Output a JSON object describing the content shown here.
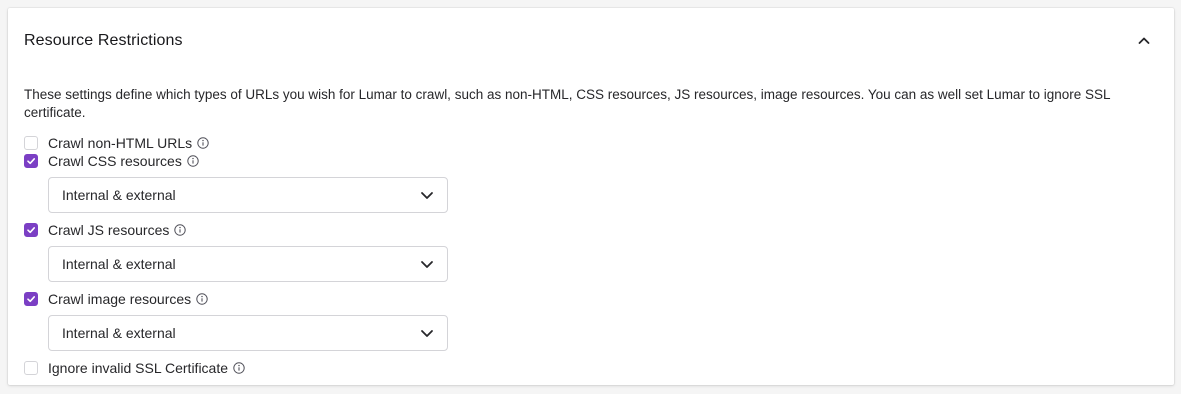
{
  "section": {
    "title": "Resource Restrictions",
    "description": "These settings define which types of URLs you wish for Lumar to crawl, such as non-HTML, CSS resources, JS resources, image resources. You can as well set Lumar to ignore SSL certificate."
  },
  "options": {
    "non_html": {
      "label": "Crawl non-HTML URLs",
      "checked": false
    },
    "css": {
      "label": "Crawl CSS resources",
      "checked": true,
      "select_value": "Internal & external"
    },
    "js": {
      "label": "Crawl JS resources",
      "checked": true,
      "select_value": "Internal & external"
    },
    "images": {
      "label": "Crawl image resources",
      "checked": true,
      "select_value": "Internal & external"
    },
    "ssl": {
      "label": "Ignore invalid SSL Certificate",
      "checked": false
    }
  },
  "colors": {
    "accent": "#7b3fc4",
    "border": "#d4d4d8",
    "text": "#27272a"
  },
  "icons": {
    "collapse": "chevron-up-icon",
    "info": "info-icon",
    "dropdown": "chevron-down-icon",
    "check": "checkmark-icon"
  }
}
